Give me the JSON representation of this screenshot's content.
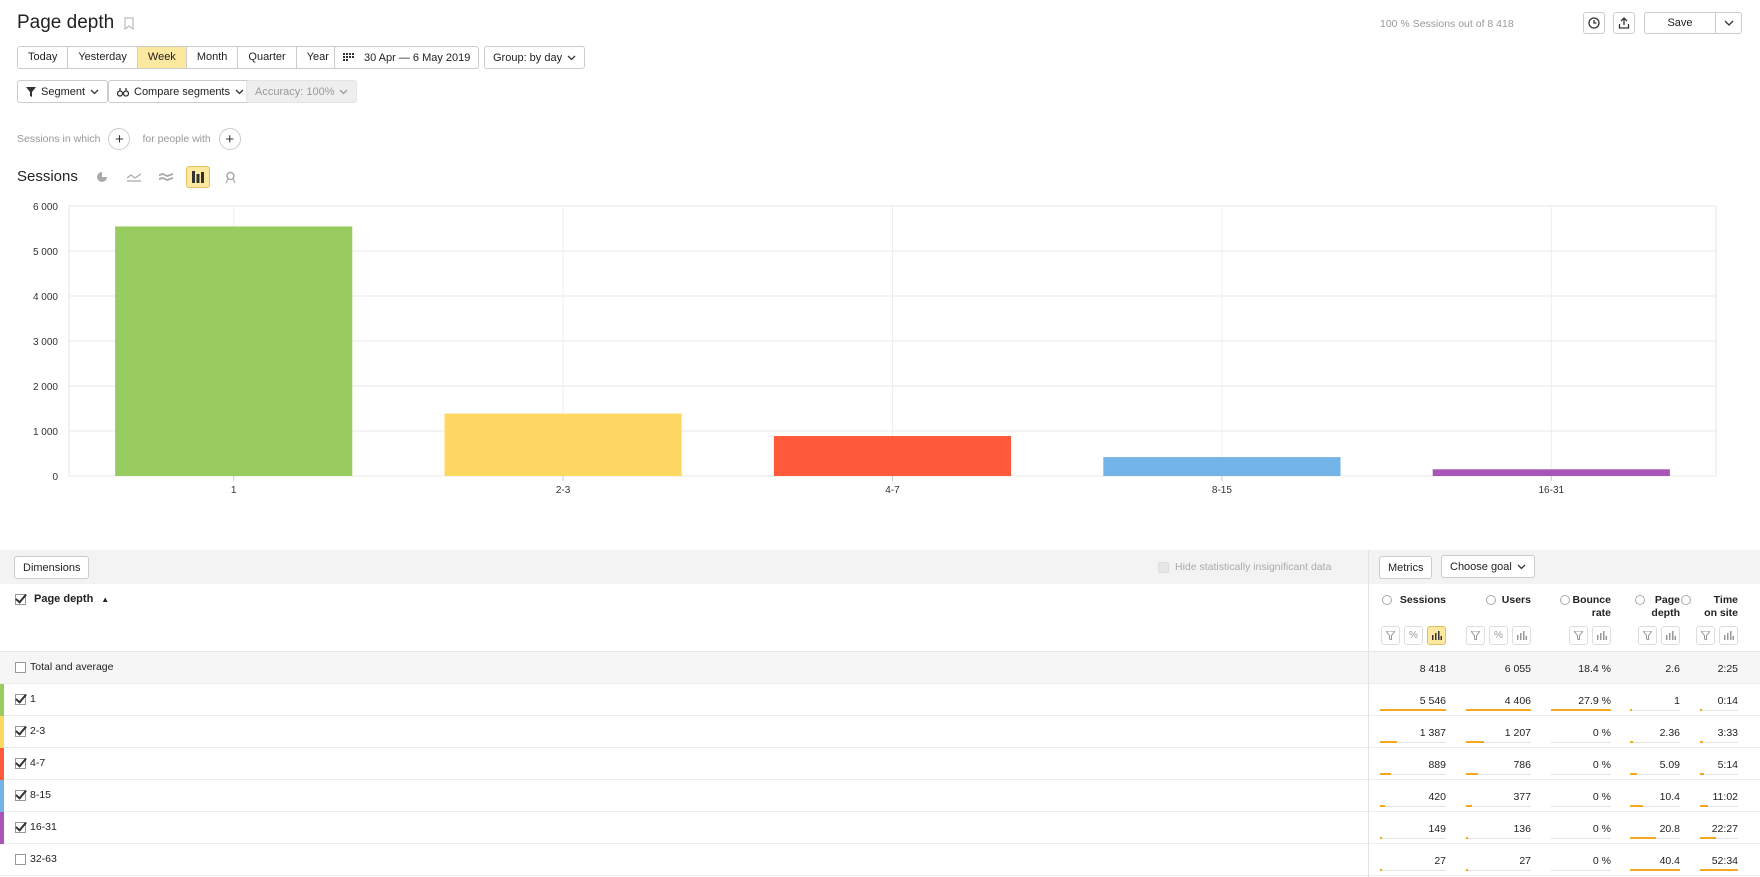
{
  "header": {
    "title": "Page depth",
    "sessions_info": "100 % Sessions out of 8 418",
    "save_label": "Save"
  },
  "periods": [
    {
      "label": "Today",
      "active": false
    },
    {
      "label": "Yesterday",
      "active": false
    },
    {
      "label": "Week",
      "active": true
    },
    {
      "label": "Month",
      "active": false
    },
    {
      "label": "Quarter",
      "active": false
    },
    {
      "label": "Year",
      "active": false
    }
  ],
  "date_range": "30 Apr — 6 May 2019",
  "group_by": "Group: by day",
  "segment_label": "Segment",
  "compare_label": "Compare segments",
  "accuracy_label": "Accuracy: 100%",
  "filter": {
    "sessions_in_which": "Sessions in which",
    "for_people_with": "for people with"
  },
  "sessions_title": "Sessions",
  "colors": {
    "accent": "#fde8a0",
    "bar_indicator": "#f5a623"
  },
  "chart_data": {
    "type": "bar",
    "categories": [
      "1",
      "2-3",
      "4-7",
      "8-15",
      "16-31"
    ],
    "values": [
      5546,
      1387,
      889,
      420,
      149
    ],
    "colors": [
      "#98cc60",
      "#fdd862",
      "#ff5a3c",
      "#72b4e8",
      "#a855b8"
    ],
    "ylim": [
      0,
      6000
    ],
    "yticks": [
      0,
      1000,
      2000,
      3000,
      4000,
      5000,
      6000
    ],
    "ytick_labels": [
      "0",
      "1 000",
      "2 000",
      "3 000",
      "4 000",
      "5 000",
      "6 000"
    ],
    "grid": true
  },
  "table": {
    "dimensions_label": "Dimensions",
    "hide_insignificant": "Hide statistically insignificant data",
    "metrics_label": "Metrics",
    "choose_goal_label": "Choose goal",
    "dimension_header": "Page depth",
    "sort_indicator": "▲",
    "metric_headers": [
      {
        "line1": "Sessions",
        "line2": ""
      },
      {
        "line1": "Users",
        "line2": ""
      },
      {
        "line1": "Bounce",
        "line2": "rate"
      },
      {
        "line1": "Page",
        "line2": "depth"
      },
      {
        "line1": "Time",
        "line2": "on site"
      }
    ],
    "total": {
      "label": "Total and average",
      "values": [
        "8 418",
        "6 055",
        "18.4 %",
        "2.6",
        "2:25"
      ]
    },
    "rows": [
      {
        "label": "1",
        "checked": true,
        "color": "#98cc60",
        "values": [
          "5 546",
          "4 406",
          "27.9 %",
          "1",
          "0:14"
        ],
        "fractions": [
          1.0,
          1.0,
          1.0,
          0.03,
          0.01
        ]
      },
      {
        "label": "2-3",
        "checked": true,
        "color": "#fdd862",
        "values": [
          "1 387",
          "1 207",
          "0 %",
          "2.36",
          "3:33"
        ],
        "fractions": [
          0.25,
          0.27,
          0,
          0.06,
          0.07
        ]
      },
      {
        "label": "4-7",
        "checked": true,
        "color": "#ff5a3c",
        "values": [
          "889",
          "786",
          "0 %",
          "5.09",
          "5:14"
        ],
        "fractions": [
          0.16,
          0.18,
          0,
          0.13,
          0.1
        ]
      },
      {
        "label": "8-15",
        "checked": true,
        "color": "#72b4e8",
        "values": [
          "420",
          "377",
          "0 %",
          "10.4",
          "11:02"
        ],
        "fractions": [
          0.08,
          0.09,
          0,
          0.26,
          0.21
        ]
      },
      {
        "label": "16-31",
        "checked": true,
        "color": "#a855b8",
        "values": [
          "149",
          "136",
          "0 %",
          "20.8",
          "22:27"
        ],
        "fractions": [
          0.03,
          0.03,
          0,
          0.51,
          0.43
        ]
      },
      {
        "label": "32-63",
        "checked": false,
        "color": "",
        "values": [
          "27",
          "27",
          "0 %",
          "40.4",
          "52:34"
        ],
        "fractions": [
          0.005,
          0.006,
          0,
          1.0,
          1.0
        ]
      }
    ]
  }
}
